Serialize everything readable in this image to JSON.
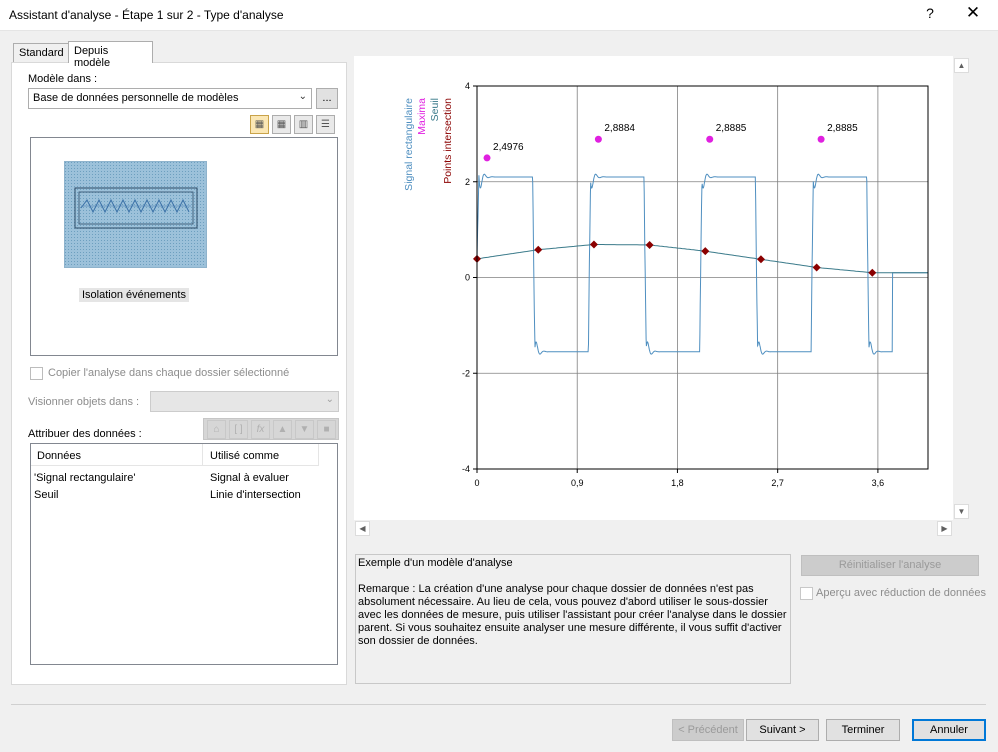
{
  "window": {
    "title": "Assistant d'analyse - Étape 1 sur 2 - Type d'analyse",
    "help_glyph": "?",
    "close_glyph": "✕"
  },
  "tabs": [
    "Standard",
    "Depuis modèle"
  ],
  "left": {
    "model_in_label": "Modèle dans :",
    "model_source": "Base de données personnelle de modèles",
    "browse_label": "...",
    "selected_template": "Isolation événements",
    "copy_checkbox_label": "Copier l'analyse dans chaque dossier sélectionné",
    "copy_checked": false,
    "view_objects_label": "Visionner objets dans :",
    "view_objects_value": "",
    "assign_label": "Attribuer des données :",
    "table": {
      "columns": [
        "Données",
        "Utilisé comme"
      ],
      "rows": [
        [
          "'Signal rectangulaire'",
          "Signal à evaluer"
        ],
        [
          "Seuil",
          "Linie d'intersection"
        ]
      ]
    }
  },
  "chart_data": {
    "type": "line",
    "series": [
      {
        "name": "Signal rectangulaire",
        "color": "#4f8fc0"
      },
      {
        "name": "Maxima",
        "color": "#e020e0",
        "points": [
          [
            0.09,
            2.4976
          ],
          [
            1.09,
            2.8884
          ],
          [
            2.09,
            2.8885
          ],
          [
            3.09,
            2.8885
          ]
        ]
      },
      {
        "name": "Seuil",
        "color": "#3a7a8a"
      },
      {
        "name": "Points intersection",
        "color": "#8b0000",
        "points": [
          [
            0.0,
            0.39
          ],
          [
            0.55,
            0.58
          ],
          [
            1.05,
            0.69
          ],
          [
            1.55,
            0.68
          ],
          [
            2.05,
            0.55
          ],
          [
            2.55,
            0.38
          ],
          [
            3.05,
            0.21
          ],
          [
            3.55,
            0.1
          ]
        ]
      }
    ],
    "max_labels": [
      "2,4976",
      "2,8884",
      "2,8885",
      "2,8885"
    ],
    "xlim": [
      0,
      4.05
    ],
    "ylim": [
      -4,
      4
    ],
    "x_ticks": [
      "0",
      "0,9",
      "1,8",
      "2,7",
      "3,6"
    ],
    "y_ticks": [
      "4",
      "2",
      "0",
      "-2",
      "-4"
    ],
    "grid": true
  },
  "description": {
    "heading": "Exemple d'un modèle d'analyse",
    "remark": "Remarque : La création d'une analyse pour chaque dossier de données n'est pas absolument nécessaire. Au lieu de cela, vous pouvez d'abord utiliser le sous-dossier avec les données de mesure, puis utiliser l'assistant pour créer l'analyse dans le dossier parent. Si vous souhaitez ensuite analyser une mesure différente, il vous suffit d'activer son dossier de données."
  },
  "right_actions": {
    "reset_label": "Réinitialiser l'analyse",
    "preview_label": "Aperçu avec réduction de données",
    "preview_checked": false
  },
  "footer": {
    "prev_label": "< Précédent",
    "next_label": "Suivant >",
    "finish_label": "Terminer",
    "cancel_label": "Annuler"
  }
}
